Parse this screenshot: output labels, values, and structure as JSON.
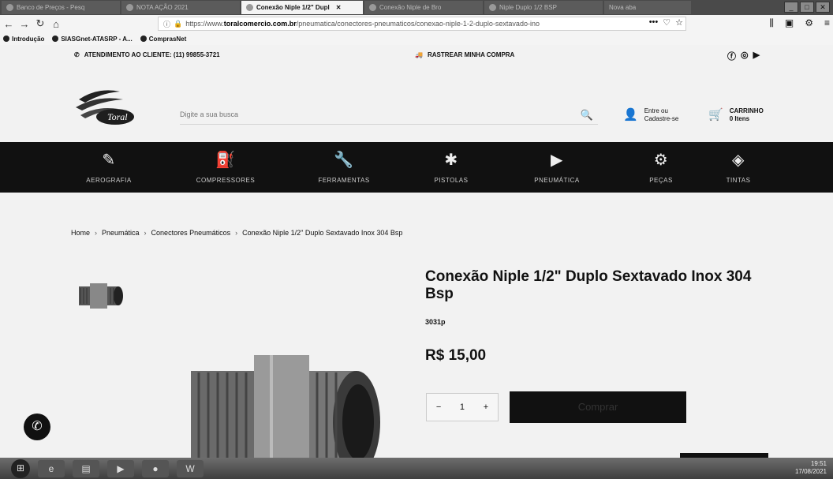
{
  "browser": {
    "tabs": [
      {
        "label": "Banco de Preços - Pesq",
        "active": false
      },
      {
        "label": "NOTA AÇÃO 2021",
        "active": false
      },
      {
        "label": "Conexão Niple 1/2\" Dupl",
        "active": true
      },
      {
        "label": "Conexão Niple de Bro",
        "active": false
      },
      {
        "label": "Niple Duplo 1/2 BSP",
        "active": false
      },
      {
        "label": "Nova aba",
        "active": false
      }
    ],
    "url_prefix": "https://www.",
    "url_domain": "toralcomercio.com.br",
    "url_path": "/pneumatica/conectores-pneumaticos/conexao-niple-1-2-duplo-sextavado-ino",
    "bookmarks": [
      "Introdução",
      "SIASGnet-ATASRP - A...",
      "ComprasNet"
    ]
  },
  "topbar": {
    "service": "ATENDIMENTO AO CLIENTE: (11) 99855-3721",
    "track": "RASTREAR MINHA COMPRA"
  },
  "header": {
    "logo_text": "Toral",
    "search_placeholder": "Digite a sua busca",
    "account_line1": "Entre ou",
    "account_line2": "Cadastre-se",
    "cart_title": "CARRINHO",
    "cart_items": "0 Itens"
  },
  "categories": [
    {
      "label": "AEROGRAFIA",
      "icon": "airbrush-icon"
    },
    {
      "label": "COMPRESSORES",
      "icon": "compressor-icon"
    },
    {
      "label": "FERRAMENTAS",
      "icon": "tool-icon"
    },
    {
      "label": "PISTOLAS",
      "icon": "spray-gun-icon"
    },
    {
      "label": "PNEUMÁTICA",
      "icon": "pneumatic-icon"
    },
    {
      "label": "PEÇAS",
      "icon": "parts-icon"
    },
    {
      "label": "TINTAS",
      "icon": "paint-icon"
    }
  ],
  "breadcrumb": [
    "Home",
    "Pneumática",
    "Conectores Pneumáticos",
    "Conexão Niple 1/2\" Duplo Sextavado Inox 304 Bsp"
  ],
  "product": {
    "title": "Conexão Niple 1/2\" Duplo Sextavado Inox 304 Bsp",
    "sku": "3031p",
    "price": "R$ 15,00",
    "quantity": "1",
    "buy_label": "Comprar"
  },
  "taskbar": {
    "time": "19:51",
    "date": "17/08/2021"
  }
}
